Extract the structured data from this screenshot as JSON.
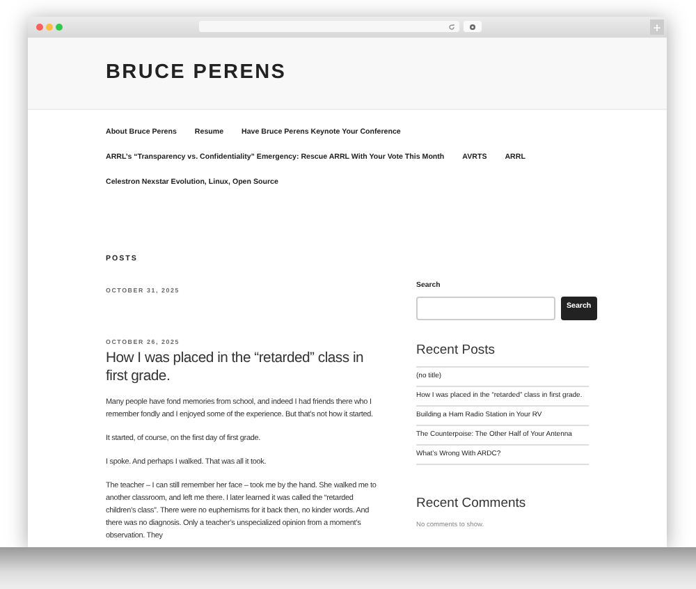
{
  "site_title": "BRUCE PERENS",
  "nav": [
    [
      "About Bruce Perens",
      "Resume",
      "Have Bruce Perens Keynote Your Conference"
    ],
    [
      "ARRL’s “Transparency vs. Confidentiality” Emergency: Rescue ARRL With Your Vote This Month",
      "AVRTS",
      "ARRL"
    ],
    [
      "Celestron Nexstar Evolution, Linux, Open Source"
    ]
  ],
  "posts_heading": "POSTS",
  "posts": [
    {
      "date": "OCTOBER 31, 2025"
    },
    {
      "date": "OCTOBER 26, 2025",
      "title": "How I was placed in the “retarded” class in first grade.",
      "paragraphs": [
        "Many people have fond memories from school, and indeed I had friends there who I remember fondly and I enjoyed some of the experience. But that’s not how it started.",
        "It started, of course, on the first day of first grade.",
        "I spoke. And perhaps I walked. That was all it took.",
        "The teacher – I can still remember her face – took me by the hand. She walked me to another classroom, and left me there. I later learned it was called the “retarded children’s class”. There were no euphemisms for it back then, no kinder words. And there was no diagnosis. Only a teacher’s unspecialized opinion from a moment’s observation. They"
      ]
    }
  ],
  "sidebar": {
    "search": {
      "label": "Search",
      "button": "Search"
    },
    "recent_posts": {
      "heading": "Recent Posts",
      "items": [
        "(no title)",
        "How I was placed in the “retarded” class in first grade.",
        "Building a Ham Radio Station in Your RV",
        "The Counterpoise: The Other Half of Your Antenna",
        "What’s Wrong With ARDC?"
      ]
    },
    "recent_comments": {
      "heading": "Recent Comments",
      "text": "No comments to show."
    }
  }
}
